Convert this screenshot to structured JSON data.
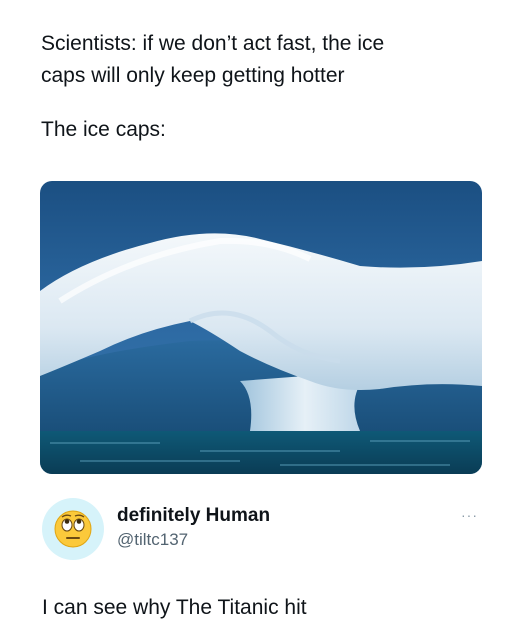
{
  "post": {
    "text_line_1": "Scientists: if we don’t act fast, the ice",
    "text_line_2": "caps will only keep getting hotter",
    "text_line_3": "The ice caps:"
  },
  "media": {
    "icon": "iceberg-photo"
  },
  "reply": {
    "display_name": "definitely Human",
    "handle": "@tiltc137",
    "text": "I can see why The Titanic hit",
    "avatar_icon": "rolling-eyes-emoji",
    "avatar_bg": "#d6f3fa",
    "more_icon": "more-options-icon",
    "more_label": "···"
  },
  "colors": {
    "text": "#0f1419",
    "secondary": "#536471"
  }
}
